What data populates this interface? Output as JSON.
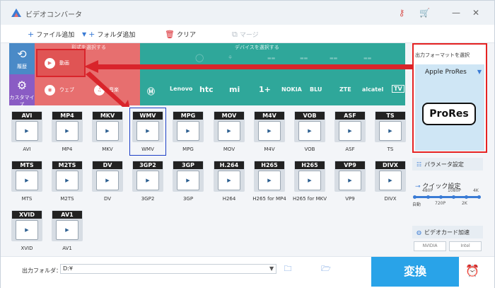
{
  "window": {
    "title": "ビデオコンバータ"
  },
  "toolbar": {
    "add_file": "ファイル追加",
    "add_folder": "フォルダ追加",
    "clear": "クリア",
    "merge": "マージ"
  },
  "categories": {
    "format_band_label": "形式を選択する",
    "device_band_label": "デバイスを選択する",
    "history": "履歴",
    "custom": "カスタマイズ",
    "video": "動画",
    "web": "ウェブ",
    "audio": "音楽",
    "brands_row1": [
      "",
      "",
      "",
      "",
      "",
      "",
      "",
      "",
      "",
      ""
    ],
    "brands_row2": [
      "Lenovo",
      "htc",
      "mi",
      "1+",
      "NOKIA",
      "BLU",
      "ZTE",
      "alcatel",
      "TV"
    ]
  },
  "formats": [
    {
      "tag": "AVI",
      "label": "AVI",
      "icon": "film-icon"
    },
    {
      "tag": "MP4",
      "label": "MP4",
      "icon": "film-icon"
    },
    {
      "tag": "MKV",
      "label": "MKV",
      "icon": "matroska-icon"
    },
    {
      "tag": "WMV",
      "label": "WMV",
      "icon": "film-icon"
    },
    {
      "tag": "MPG",
      "label": "MPG",
      "icon": "film-icon"
    },
    {
      "tag": "MOV",
      "label": "MOV",
      "icon": "quicktime-icon"
    },
    {
      "tag": "M4V",
      "label": "M4V",
      "icon": "itunes-icon"
    },
    {
      "tag": "VOB",
      "label": "VOB",
      "icon": "disc-icon"
    },
    {
      "tag": "ASF",
      "label": "ASF",
      "icon": "film-icon"
    },
    {
      "tag": "TS",
      "label": "TS",
      "icon": "film-icon"
    },
    {
      "tag": "MTS",
      "label": "MTS",
      "icon": "camcorder-icon"
    },
    {
      "tag": "M2TS",
      "label": "M2TS",
      "icon": "camcorder-icon"
    },
    {
      "tag": "DV",
      "label": "DV",
      "icon": "camcorder-icon"
    },
    {
      "tag": "3GP2",
      "label": "3GP2",
      "icon": "phone-icon"
    },
    {
      "tag": "3GP",
      "label": "3GP",
      "icon": "phone-icon"
    },
    {
      "tag": "H.264",
      "label": "H264",
      "icon": "encoder-icon"
    },
    {
      "tag": "H265",
      "label": "H265 for MP4",
      "icon": "hevc-icon"
    },
    {
      "tag": "H265",
      "label": "H265 for MKV",
      "icon": "hevc-icon"
    },
    {
      "tag": "VP9",
      "label": "VP9",
      "icon": "vp9-icon"
    },
    {
      "tag": "DIVX",
      "label": "DIVX",
      "icon": "encoder-icon"
    },
    {
      "tag": "XVID",
      "label": "XVID",
      "icon": "encoder-icon"
    },
    {
      "tag": "AV1",
      "label": "AV1",
      "icon": "encoder-icon"
    }
  ],
  "selected_format": "WMV",
  "output_panel": {
    "label": "出力フォーマットを選択",
    "selected": "Apple ProRes",
    "badge": "ProRes"
  },
  "params_button": "パラメータ設定",
  "quick_settings": {
    "label": "クイック設定",
    "ticks_top": [
      "480P",
      "1080P",
      "4K"
    ],
    "ticks_bottom": [
      "自動",
      "720P",
      "2K"
    ]
  },
  "gpu": {
    "label": "ビデオカード加速",
    "chips": [
      "NVIDIA",
      "Intel"
    ]
  },
  "bottom": {
    "output_folder_label": "出力フォルダ：",
    "output_folder_value": "D:¥",
    "convert_label": "変換"
  },
  "colors": {
    "format_band": "#e76f6f",
    "device_band": "#2fa79a",
    "highlight": "#e52222",
    "convert": "#29a3e8"
  }
}
